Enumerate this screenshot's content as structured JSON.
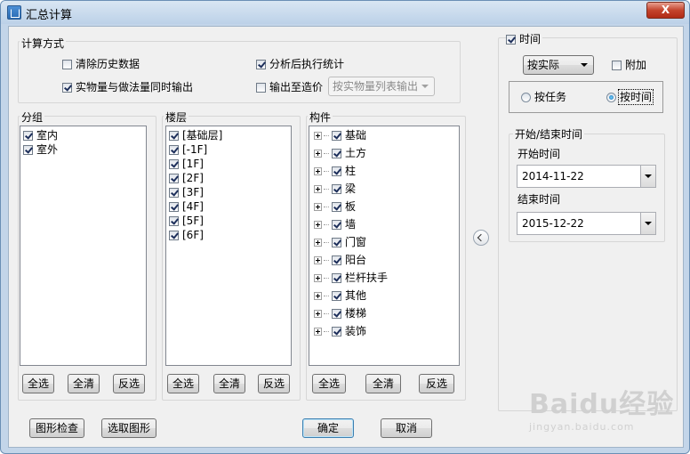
{
  "window": {
    "title": "汇总计算",
    "close_label": "X"
  },
  "calc_method": {
    "group_label": "计算方式",
    "clear_history": {
      "label": "清除历史数据",
      "checked": false
    },
    "output_both": {
      "label": "实物量与做法量同时输出",
      "checked": true
    },
    "stats_after": {
      "label": "分析后执行统计",
      "checked": true
    },
    "output_cost": {
      "label": "输出至造价",
      "checked": false
    },
    "output_mode": {
      "value": "按实物量列表输出",
      "disabled": true
    }
  },
  "group": {
    "label": "分组",
    "items": [
      {
        "label": "室内",
        "checked": true
      },
      {
        "label": "室外",
        "checked": true
      }
    ],
    "buttons": {
      "select_all": "全选",
      "clear_all": "全清",
      "invert": "反选"
    }
  },
  "floor": {
    "label": "楼层",
    "items": [
      {
        "label": "[基础层]",
        "checked": true
      },
      {
        "label": "[-1F]",
        "checked": true
      },
      {
        "label": "[1F]",
        "checked": true
      },
      {
        "label": "[2F]",
        "checked": true
      },
      {
        "label": "[3F]",
        "checked": true
      },
      {
        "label": "[4F]",
        "checked": true
      },
      {
        "label": "[5F]",
        "checked": true
      },
      {
        "label": "[6F]",
        "checked": true
      }
    ],
    "buttons": {
      "select_all": "全选",
      "clear_all": "全清",
      "invert": "反选"
    }
  },
  "component": {
    "label": "构件",
    "items": [
      {
        "label": "基础",
        "checked": true
      },
      {
        "label": "土方",
        "checked": true
      },
      {
        "label": "柱",
        "checked": true
      },
      {
        "label": "梁",
        "checked": true
      },
      {
        "label": "板",
        "checked": true
      },
      {
        "label": "墙",
        "checked": true
      },
      {
        "label": "门窗",
        "checked": true
      },
      {
        "label": "阳台",
        "checked": true
      },
      {
        "label": "栏杆扶手",
        "checked": true
      },
      {
        "label": "其他",
        "checked": true
      },
      {
        "label": "楼梯",
        "checked": true
      },
      {
        "label": "装饰",
        "checked": true
      }
    ],
    "buttons": {
      "select_all": "全选",
      "clear_all": "全清",
      "invert": "反选"
    }
  },
  "time_panel": {
    "time_checkbox": {
      "label": "时间",
      "checked": true
    },
    "mode_select": "按实际",
    "append": {
      "label": "附加",
      "checked": false
    },
    "by_task": {
      "label": "按任务",
      "checked": false
    },
    "by_time": {
      "label": "按时间",
      "checked": true
    },
    "range_group_label": "开始/结束时间",
    "start_label": "开始时间",
    "start_value": "2014-11-22",
    "end_label": "结束时间",
    "end_value": "2015-12-22"
  },
  "footer": {
    "shape_check": "图形检查",
    "select_shape": "选取图形",
    "ok": "确定",
    "cancel": "取消"
  },
  "watermark": {
    "text": "Baidu经验",
    "url_text": "jingyan.baidu.com"
  }
}
